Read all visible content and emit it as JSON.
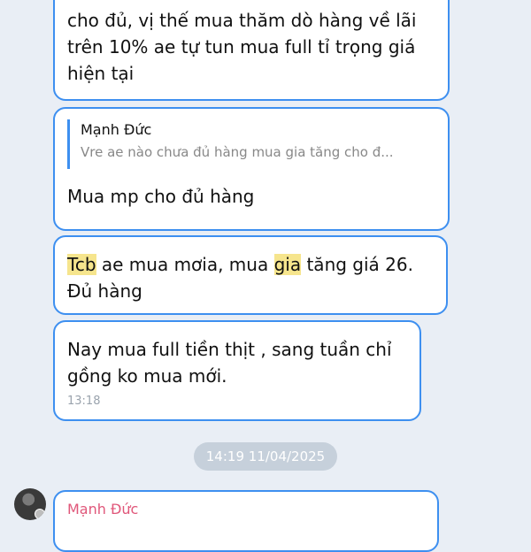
{
  "messages": [
    {
      "line1": "cho đủ, vị thế mua thăm dò hàng về lãi",
      "line2": "trên 10% ae tự tun mua full tỉ trọng giá",
      "line3": "hiện tại"
    },
    {
      "reply_author": "Mạnh Đức",
      "reply_snippet": "Vre ae nào chưa đủ hàng mua gia tăng cho đ...",
      "text": "Mua mp cho đủ hàng"
    },
    {
      "hl1": "Tcb",
      "part1": " ae mua mơia, mua ",
      "hl2": "gia",
      "part2": " tăng giá 26.",
      "line2": "Đủ hàng"
    },
    {
      "line1": "Nay mua full tiền thịt , sang tuần chỉ",
      "line2": "gồng ko mua mới.",
      "time": "13:18"
    }
  ],
  "date_separator": "14:19 11/04/2025",
  "next_message": {
    "author": "Mạnh Đức"
  }
}
